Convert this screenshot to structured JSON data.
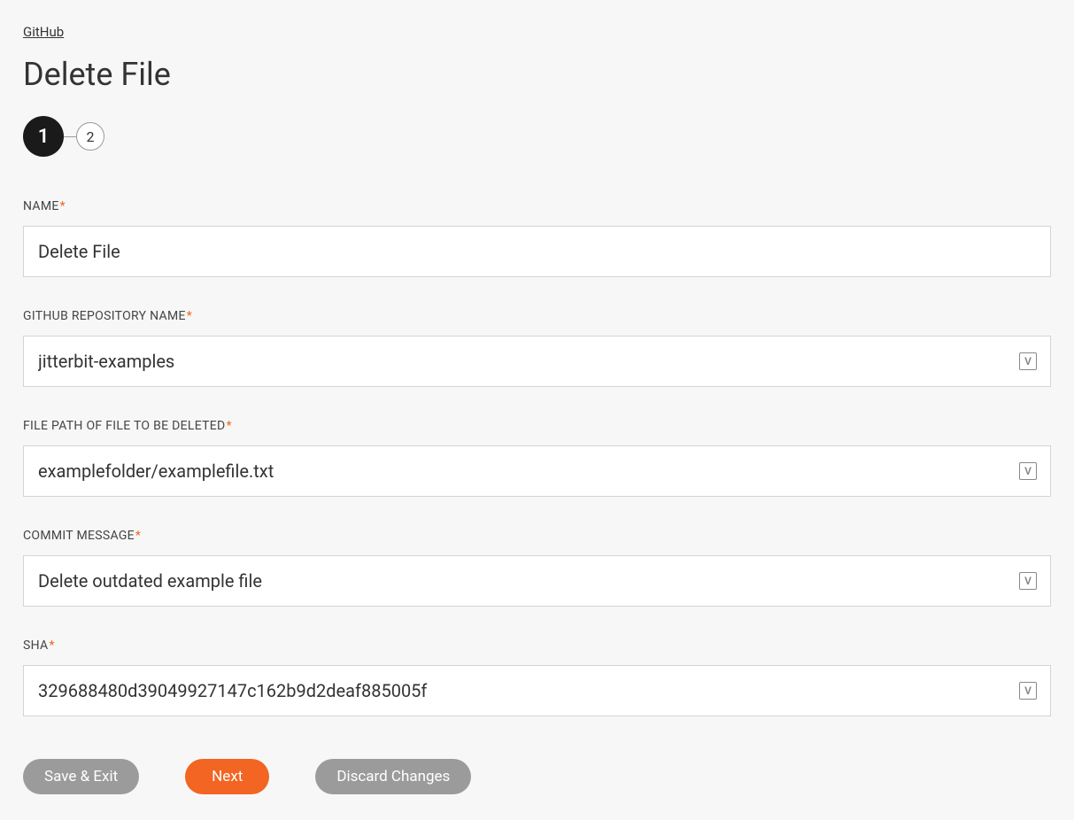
{
  "breadcrumb": "GitHub",
  "page_title": "Delete File",
  "stepper": {
    "current": "1",
    "next": "2"
  },
  "fields": {
    "name": {
      "label": "NAME",
      "required": "*",
      "value": "Delete File"
    },
    "repo": {
      "label": "GITHUB REPOSITORY NAME",
      "required": "*",
      "value": "jitterbit-examples"
    },
    "filepath": {
      "label": "FILE PATH OF FILE TO BE DELETED",
      "required": "*",
      "value": "examplefolder/examplefile.txt"
    },
    "commit": {
      "label": "COMMIT MESSAGE",
      "required": "*",
      "value": "Delete outdated example file"
    },
    "sha": {
      "label": "SHA",
      "required": "*",
      "value": "329688480d39049927147c162b9d2deaf885005f"
    }
  },
  "icons": {
    "variable": "V"
  },
  "buttons": {
    "save_exit": "Save & Exit",
    "next": "Next",
    "discard": "Discard Changes"
  }
}
